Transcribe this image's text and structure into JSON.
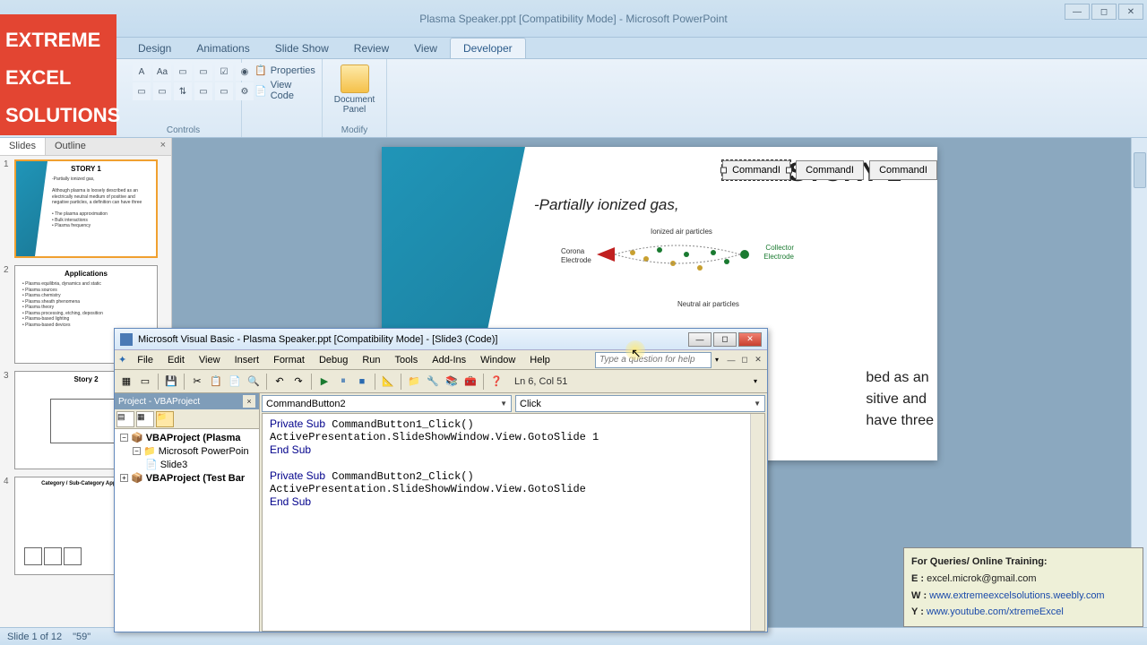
{
  "logo": {
    "line1": "EXTREME",
    "line2": "EXCEL",
    "line3": "SOLUTIONS"
  },
  "titlebar": {
    "title": "Plasma Speaker.ppt [Compatibility Mode] - Microsoft PowerPoint"
  },
  "ribbon_tabs": [
    "Design",
    "Animations",
    "Slide Show",
    "Review",
    "View",
    "Developer"
  ],
  "ribbon": {
    "properties": "Properties",
    "view_code": "View Code",
    "controls_label": "Controls",
    "doc_panel_line1": "Document",
    "doc_panel_line2": "Panel",
    "modify_label": "Modify"
  },
  "slide_panel": {
    "tabs": [
      "Slides",
      "Outline"
    ],
    "thumbs": [
      {
        "num": "1",
        "title": "STORY 1",
        "text": "-Partially ionized gas,\n\nAlthough plasma is loosely described as an electrically neutral medium of positive and negative particles, a definition can have three\n\n• The plasma approximation\n• Bulk interactions\n• Plasma frequency"
      },
      {
        "num": "2",
        "title": "Applications",
        "text": "• Plasma equilibria, dynamics and static\n• Plasma sources\n• Plasma chemistry\n• Plasma sheath phenomena\n• Plasma theory\n• Plasma processing, etching, deposition\n• Plasma-based lighting\n• Plasma-based devices"
      },
      {
        "num": "3",
        "title": "Story 2",
        "text": ""
      },
      {
        "num": "4",
        "title": "Category / Sub-Category Approach",
        "text": ""
      }
    ]
  },
  "slide": {
    "title": "STORY 1",
    "subtitle": "-Partially ionized gas,",
    "cmd1": "CommandI",
    "cmd2": "CommandI",
    "cmd3": "CommandI",
    "diagram": {
      "top": "Ionized air particles",
      "left1": "Corona",
      "left2": "Electrode",
      "right1": "Collector",
      "right2": "Electrode",
      "bottom": "Neutral air particles"
    },
    "body1": "bed as an",
    "body2": "sitive and",
    "body3": "have three"
  },
  "statusbar": {
    "slide": "Slide 1 of 12",
    "lang": "\"59\""
  },
  "vba": {
    "title": "Microsoft Visual Basic - Plasma Speaker.ppt [Compatibility Mode] - [Slide3 (Code)]",
    "menu": [
      "File",
      "Edit",
      "View",
      "Insert",
      "Format",
      "Debug",
      "Run",
      "Tools",
      "Add-Ins",
      "Window",
      "Help"
    ],
    "help_placeholder": "Type a question for help",
    "cursor_pos": "Ln 6, Col 51",
    "project_title": "Project - VBAProject",
    "tree": {
      "proj1": "VBAProject (Plasma",
      "pp": "Microsoft PowerPoin",
      "slide": "Slide3",
      "proj2": "VBAProject (Test Bar"
    },
    "dd_object": "CommandButton2",
    "dd_proc": "Click",
    "code_lines": [
      {
        "t": "kw",
        "v": "Private Sub"
      },
      {
        "t": "n",
        "v": " CommandButton1_Click()\n"
      },
      {
        "t": "n",
        "v": "ActivePresentation.SlideShowWindow.View.GotoSlide 1\n"
      },
      {
        "t": "kw",
        "v": "End Sub"
      },
      {
        "t": "n",
        "v": "\n\n"
      },
      {
        "t": "kw",
        "v": "Private Sub"
      },
      {
        "t": "n",
        "v": " CommandButton2_Click()\n"
      },
      {
        "t": "n",
        "v": "ActivePresentation.SlideShowWindow.View.GotoSlide\n"
      },
      {
        "t": "kw",
        "v": "End Sub"
      }
    ]
  },
  "contact": {
    "header": "For Queries/ Online Training:",
    "email_lbl": "E  :",
    "email": "excel.microk@gmail.com",
    "web_lbl": "W :",
    "web": "www.extremeexcelsolutions.weebly.com",
    "yt_lbl": "Y  :",
    "yt": "www.youtube.com/xtremeExcel"
  }
}
